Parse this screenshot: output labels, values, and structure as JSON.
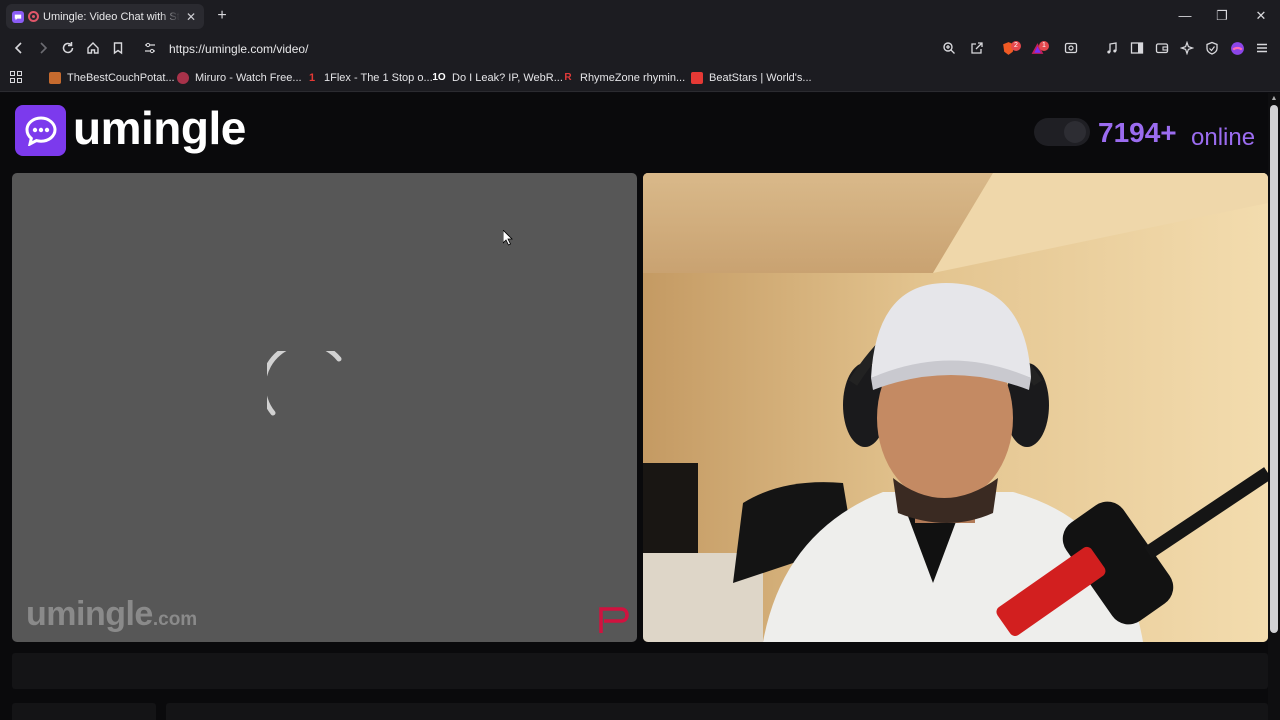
{
  "browser": {
    "tab": {
      "title": "Umingle: Video Chat with Stra",
      "close": "✕"
    },
    "new_tab": "+",
    "window_controls": {
      "minimize": "—",
      "restore": "❐",
      "close": "✕"
    },
    "url": "https://umingle.com/video/",
    "badges": {
      "brave_shields": "2",
      "rewards": "1"
    },
    "bookmarks": [
      {
        "label": "TheBestCouchPotat...",
        "icon": "couch-icon",
        "color": "#c56a2e"
      },
      {
        "label": "Miruro - Watch Free...",
        "icon": "miruro-icon",
        "color": "#c0392b"
      },
      {
        "label": "1Flex - The 1 Stop o...",
        "icon": "1flex-icon",
        "color": "#d32f2f"
      },
      {
        "label": "Do I Leak? IP, WebR...",
        "icon": "10-icon",
        "color": "#1c1c21"
      },
      {
        "label": "RhymeZone rhymin...",
        "icon": "rhymezone-icon",
        "color": "#d33"
      },
      {
        "label": "BeatStars | World's...",
        "icon": "beatstars-icon",
        "color": "#e53935"
      }
    ]
  },
  "page": {
    "logo_text": "umingle",
    "online_count": "7194+",
    "online_label": "online",
    "watermark_main": "umingle",
    "watermark_tld": ".com"
  },
  "colors": {
    "accent": "#7c3aed",
    "online": "#9b6cf0",
    "video_placeholder": "#575757"
  }
}
